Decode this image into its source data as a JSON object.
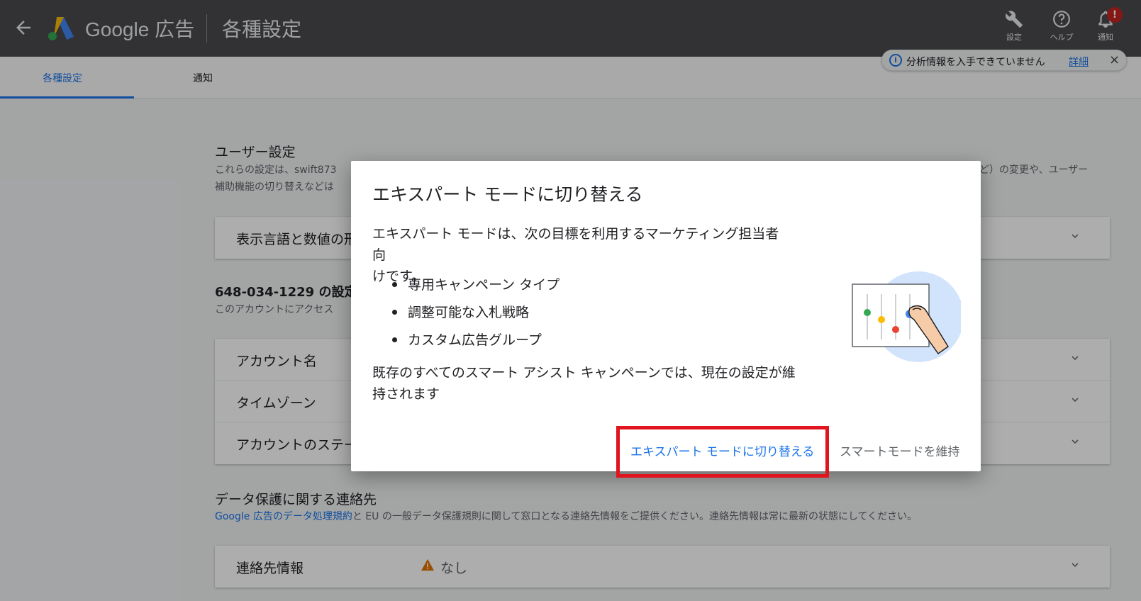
{
  "appbar": {
    "brand": "Google 広告",
    "page_title": "各種設定",
    "tools": [
      {
        "label": "設定",
        "icon": "wrench-icon"
      },
      {
        "label": "ヘルプ",
        "icon": "help-icon"
      },
      {
        "label": "通知",
        "icon": "bell-icon",
        "badge": "!"
      }
    ]
  },
  "tabs": [
    {
      "label": "各種設定",
      "active": true
    },
    {
      "label": "通知",
      "active": false
    }
  ],
  "analytics_chip": {
    "message": "分析情報を入手できていません",
    "link": "詳細",
    "close": "×"
  },
  "user_settings": {
    "title": "ユーザー設定",
    "desc_left_1": "これらの設定は、swift873",
    "desc_right_1": "ど）の変更や、ユーザー",
    "desc_left_2": "補助機能の切り替えなどは",
    "rows": [
      {
        "label": "表示言語と数値の形"
      }
    ]
  },
  "account_settings": {
    "title": "648-034-1229 の設定",
    "desc": "このアカウントにアクセス",
    "rows": [
      {
        "label": "アカウント名"
      },
      {
        "label": "タイムゾーン"
      },
      {
        "label": "アカウントのステー"
      }
    ]
  },
  "data_protection": {
    "title": "データ保護に関する連絡先",
    "link_text": "Google 広告のデータ処理規約",
    "desc_text": "と EU の一般データ保護規則に関して窓口となる連絡先情報をご提供ください。連絡先情報は常に最新の状態にしてください。",
    "row_label": "連絡先情報",
    "row_value": "なし"
  },
  "dialog": {
    "title": "エキスパート モードに切り替える",
    "body_line1": "エキスパート モードは、次の目標を利用するマーケティング担当者向",
    "body_line2": "けです。",
    "bullets": [
      "専用キャンペーン タイプ",
      "調整可能な入札戦略",
      "カスタム広告グループ"
    ],
    "footer_line1": "既存のすべてのスマート アシスト キャンペーンでは、現在の設定が維",
    "footer_line2": "持されます",
    "primary_button": "エキスパート モードに切り替える",
    "secondary_button": "スマートモードを維持"
  },
  "colors": {
    "appbar": "#4a4b4f",
    "accent": "#1a73e8",
    "highlight": "#e0151f",
    "warning": "#e37400"
  }
}
